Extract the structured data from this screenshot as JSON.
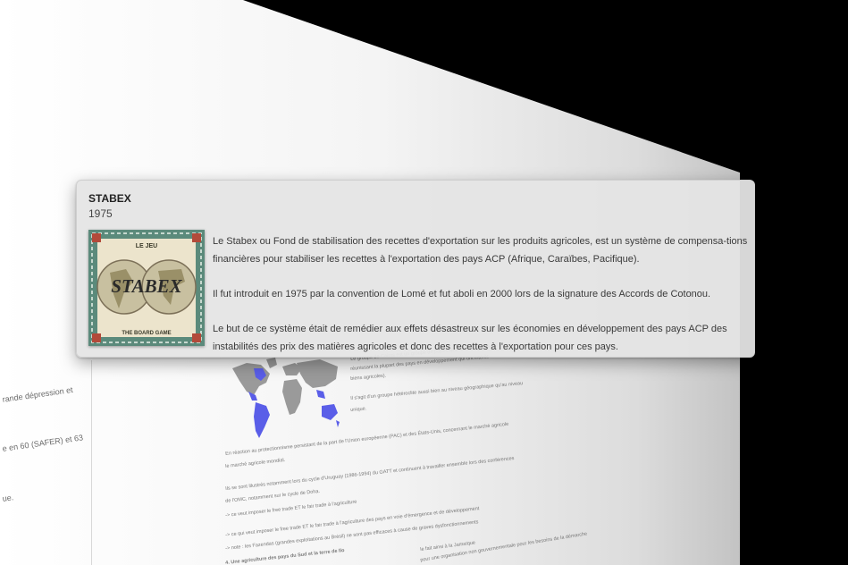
{
  "tooltip": {
    "title": "STABEX",
    "year": "1975",
    "image": {
      "top_text": "LE JEU",
      "center_text": "STABEX",
      "bottom_text": "THE BOARD GAME"
    },
    "paragraphs": [
      "Le Stabex ou Fond de stabilisation des recettes d'exportation sur les produits agricoles, est un système de compensa-tions financières pour stabiliser les recettes à l'exportation des pays ACP (Afrique, Caraïbes, Pacifique).",
      "Il fut introduit en 1975 par la convention de Lomé et fut aboli en 2000 lors de la signature des Accords de Cotonou.",
      "Le but de ce système était de remédier aux effets désastreux sur les économies en développement des pays ACP des instabilités des prix des matières agricoles et donc des recettes à l'exportation pour ces pays."
    ]
  },
  "background_page": {
    "left_fragments": [
      "rande dépression et",
      "e en 60 (SAFER) et 63",
      "ue."
    ],
    "main_lines": [
      "En réaction au protectionnisme persistant de la part de l'Union européenne (PAC) et des États-Unis, concernant le marché agricole",
      "le marché agricole mondial.",
      "Ils se sont illustrés notamment lors du cycle d'Uruguay (1986-1994) du GATT et continuent à travailler ensemble lors des conférences",
      "de l'OMC, notamment sur le cycle de Doha.",
      "-> ce veut imposer le free trade ET le fair trade à l'agriculture",
      "-> ce qui veut imposer le free trade ET le fair trade à l'agriculture des pays en voie d'émergence et de développement",
      "-> note : les Fazendas (grandes exploitations au Brésil) ne sont pas efficaces à cause de graves dysfonctionnements",
      "4. Une agriculture des pays du Sud et la terre de Ilo"
    ],
    "right_column": [
      "Le groupe de Cairns est un groupe de pays exportateurs agricoles",
      "réunissant la plupart des pays en développement qui ont intérêt",
      "biens agricoles).",
      "Il s'agit d'un groupe hétéroclite aussi bien au niveau géographique qu'au niveau",
      "unique."
    ],
    "bottom_fragments": [
      "le fait ainsi à la Jamaïque",
      "pour une organisation non gouvernementale pour les besoins de la démarche"
    ],
    "colors": {
      "map_land": "#9a9a9a",
      "map_highlight": "#5a5ee8"
    }
  }
}
